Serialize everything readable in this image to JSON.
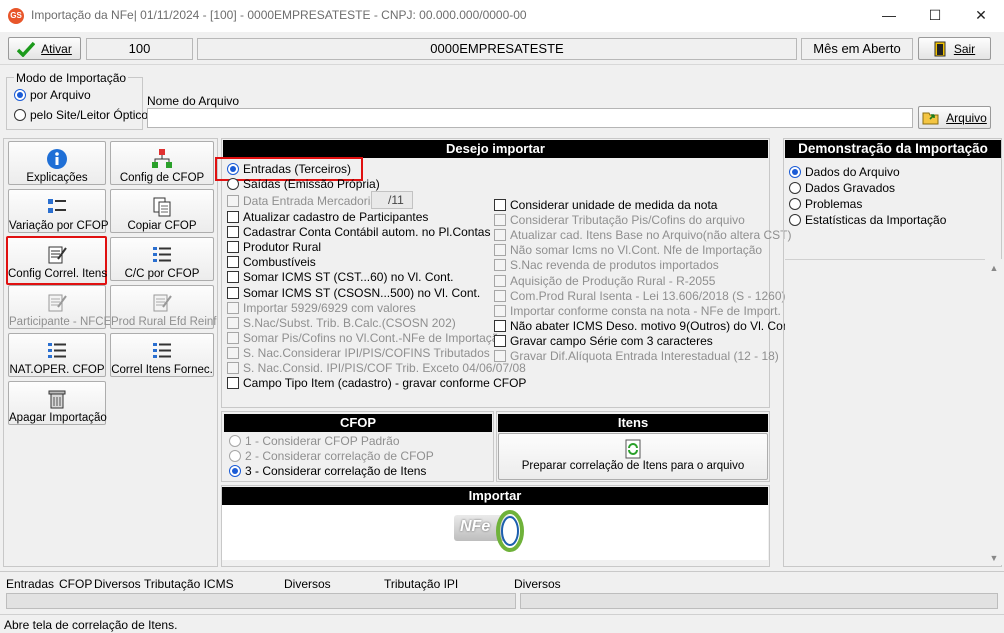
{
  "window": {
    "title": "Importação da NFe| 01/11/2024 - [100] - 0000EMPRESATESTE - CNPJ: 00.000.000/0000-00",
    "app_icon_text": "GS",
    "minimize": "—",
    "maximize": "☐",
    "close": "✕"
  },
  "toolbar": {
    "ativar_label": "Ativar",
    "code": "100",
    "company": "0000EMPRESATESTE",
    "month_status": "Mês em Aberto",
    "sair_label": "Sair"
  },
  "import_mode": {
    "legend": "Modo de Importação",
    "opt_arquivo": "por Arquivo",
    "opt_site": "pelo Site/Leitor Óptico",
    "file_label": "Nome do Arquivo",
    "file_value": "",
    "arquivo_button": "Arquivo"
  },
  "left_buttons": {
    "explicacoes": "Explicações",
    "config_cfop": "Config de CFOP",
    "variacao_cfop": "Variação por CFOP",
    "copiar_cfop": "Copiar CFOP",
    "config_correl": "Config Correl. Itens",
    "cc_cfop": "C/C por CFOP",
    "participante": "Participante - NFCE",
    "prod_rural": "Prod Rural Efd Reinf",
    "nat_oper": "NAT.OPER. CFOP",
    "correl_fornec": "Correl Itens Fornec.",
    "apagar": "Apagar Importação"
  },
  "desejo": {
    "header": "Desejo importar",
    "entradas": "Entradas (Terceiros)",
    "saidas": "Saídas (Emissão Própria)",
    "data_entrada": "Data Entrada Mercadoria",
    "data_value": "/11",
    "left": [
      "Atualizar cadastro de Participantes",
      "Cadastrar Conta Contábil autom. no Pl.Contas",
      "Produtor Rural",
      "Combustíveis",
      "Somar ICMS ST (CST...60) no Vl. Cont.",
      "Somar ICMS ST (CSOSN...500) no Vl. Cont.",
      "Importar 5929/6929 com valores",
      "S.Nac/Subst. Trib. B.Calc.(CSOSN 202)",
      "Somar Pis/Cofins no Vl.Cont.-NFe de Importação",
      "S. Nac.Considerar IPI/PIS/COFINS Tributados",
      "S. Nac.Consid. IPI/PIS/COF Trib. Exceto 04/06/07/08",
      "Campo Tipo Item (cadastro) - gravar conforme CFOP"
    ],
    "right": [
      "Considerar unidade de medida da nota",
      "Considerar Tributação Pis/Cofins do arquivo",
      "Atualizar cad. Itens Base no Arquivo(não altera CST)",
      "Não somar Icms no Vl.Cont. Nfe de Importação",
      "S.Nac revenda de produtos importados",
      "Aquisição de Produção Rural - R-2055",
      "Com.Prod Rural Isenta - Lei 13.606/2018 (S - 1260)",
      "Importar conforme consta na nota - NFe de Import.",
      "Não abater ICMS Deso. motivo 9(Outros) do Vl. Cont.",
      "Gravar campo Série com 3 caracteres",
      "Gravar Dif.Alíquota Entrada Interestadual (12 - 18)"
    ]
  },
  "cfop": {
    "header": "CFOP",
    "opt1": "1 - Considerar CFOP Padrão",
    "opt2": "2 - Considerar correlação de CFOP",
    "opt3": "3 - Considerar correlação de Itens"
  },
  "itens": {
    "header": "Itens",
    "button": "Preparar correlação de Itens para o arquivo"
  },
  "importar": {
    "header": "Importar",
    "logo_text": "NFe"
  },
  "demo": {
    "header": "Demonstração da Importação",
    "opt1": "Dados do Arquivo",
    "opt2": "Dados Gravados",
    "opt3": "Problemas",
    "opt4": "Estatísticas da Importação"
  },
  "bottom_tabs": {
    "entradas": "Entradas",
    "cfop": "CFOP",
    "diversos1": "Diversos",
    "trib_icms": "Tributação ICMS",
    "diversos2": "Diversos",
    "trib_ipi": "Tributação IPI",
    "diversos3": "Diversos"
  },
  "status": {
    "text": "Abre tela de correlação de Itens."
  }
}
